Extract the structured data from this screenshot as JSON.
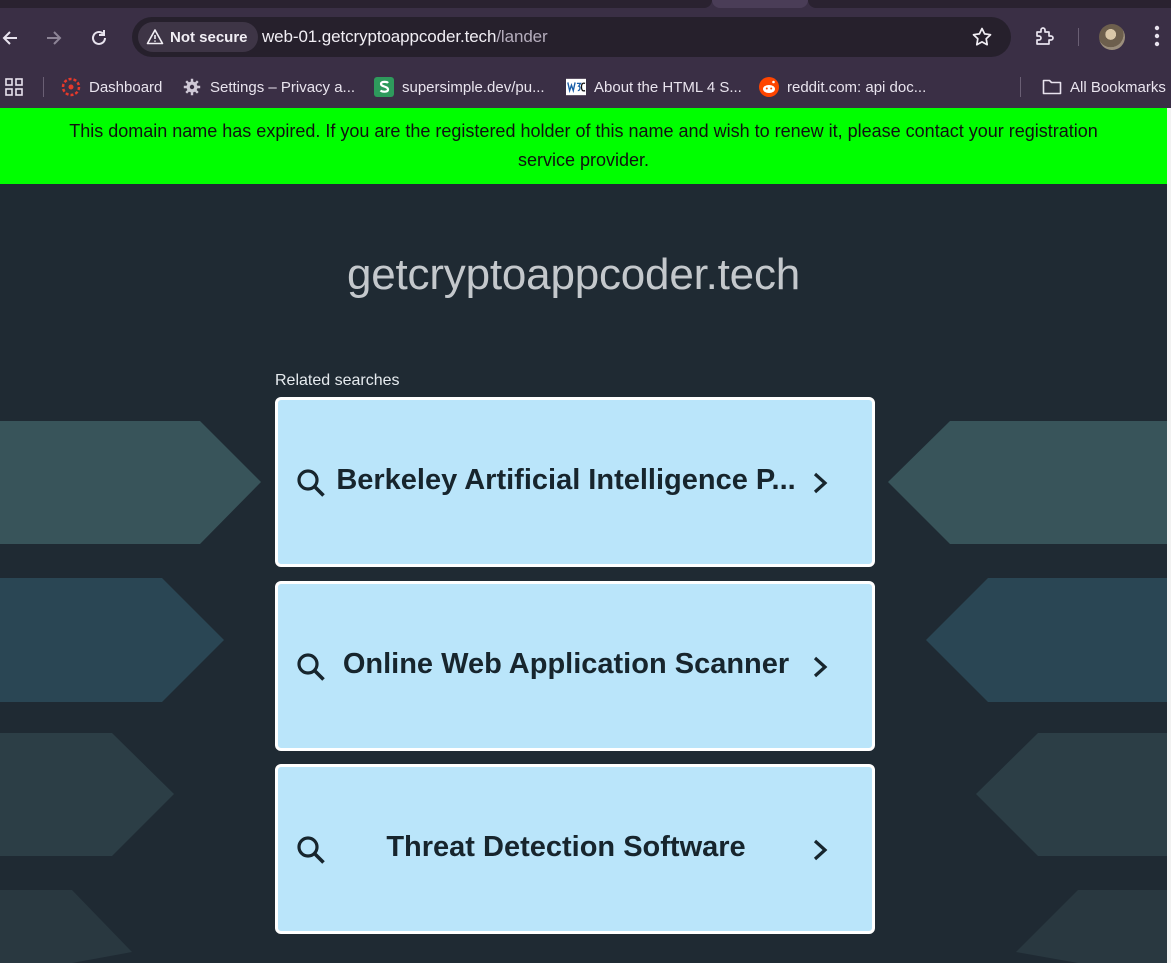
{
  "browser": {
    "security_chip": "Not secure",
    "url_host": "web-01.getcryptoappcoder.tech",
    "url_path": "/lander",
    "bookmarks": [
      {
        "label": "Dashboard"
      },
      {
        "label": "Settings – Privacy a..."
      },
      {
        "label": "supersimple.dev/pu..."
      },
      {
        "label": "About the HTML 4 S..."
      },
      {
        "label": "reddit.com: api doc..."
      }
    ],
    "all_bookmarks": "All Bookmarks"
  },
  "page": {
    "banner": "This domain name has expired. If you are the registered holder of this name and wish to renew it, please contact your registration service provider.",
    "site_title": "getcryptoappcoder.tech",
    "related_label": "Related searches",
    "searches": [
      {
        "label": "Berkeley Artificial Intelligence P..."
      },
      {
        "label": "Online Web Application Scanner"
      },
      {
        "label": "Threat Detection Software"
      }
    ]
  },
  "colors": {
    "banner_bg": "#00ff00",
    "page_bg": "#1f2a33",
    "card_bg": "#bae5fa",
    "chrome_bg": "#3a2f45"
  }
}
